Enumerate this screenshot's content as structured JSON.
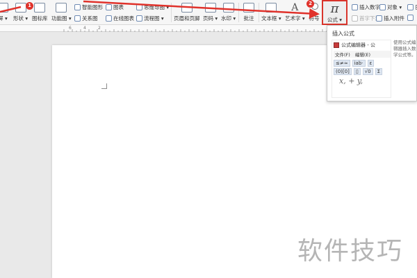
{
  "ribbon": {
    "col0": {
      "partial_label": "屏 ▾"
    },
    "shape": {
      "label": "形状 ▾"
    },
    "icon_lib": {
      "label": "图标库"
    },
    "func_chart": {
      "label": "功能图 ▾"
    },
    "smart_art": {
      "label": "智能图形"
    },
    "relation": {
      "label": "关系图"
    },
    "chart": {
      "label": "图表"
    },
    "online_chart": {
      "label": "在线图表"
    },
    "mind_map": {
      "label": "思维导图 ▾"
    },
    "flow_chart": {
      "label": "流程图 ▾"
    },
    "header_footer": {
      "label": "页眉和页脚"
    },
    "page_num": {
      "label": "页码 ▾"
    },
    "watermark": {
      "label": "水印 ▾"
    },
    "comment": {
      "label": "批注"
    },
    "textbox": {
      "label": "文本框 ▾"
    },
    "art_text": {
      "label": "艺术字 ▾"
    },
    "symbol": {
      "label": "符号"
    },
    "formula": {
      "label": "公式 ▾",
      "glyph": "π"
    },
    "insert_number": {
      "label": "插入数字"
    },
    "first_drop": {
      "label": "首字下沉"
    },
    "object": {
      "label": "对象 ▾"
    },
    "insert_attachment": {
      "label": "插入附件"
    },
    "date": {
      "label": "日"
    }
  },
  "annotations": {
    "step1": "1",
    "step2": "2",
    "arrow_color": "#e0322b"
  },
  "ruler": {
    "marks": [
      "6",
      "4",
      "2"
    ]
  },
  "popup": {
    "title": "插入公式",
    "description": "使用公式编辑器插入数学公式等。",
    "editor": {
      "title": "公式编辑器 - 公",
      "menu": [
        "文件(F)",
        "编辑(E)"
      ],
      "row1": [
        "≤≠≈",
        "ⅰab·",
        "ε"
      ],
      "row2": [
        "(0)[0]",
        "▯",
        "√0",
        "Σ"
      ],
      "formula": "x, + y,"
    }
  },
  "watermark": {
    "text": "软件技巧"
  }
}
